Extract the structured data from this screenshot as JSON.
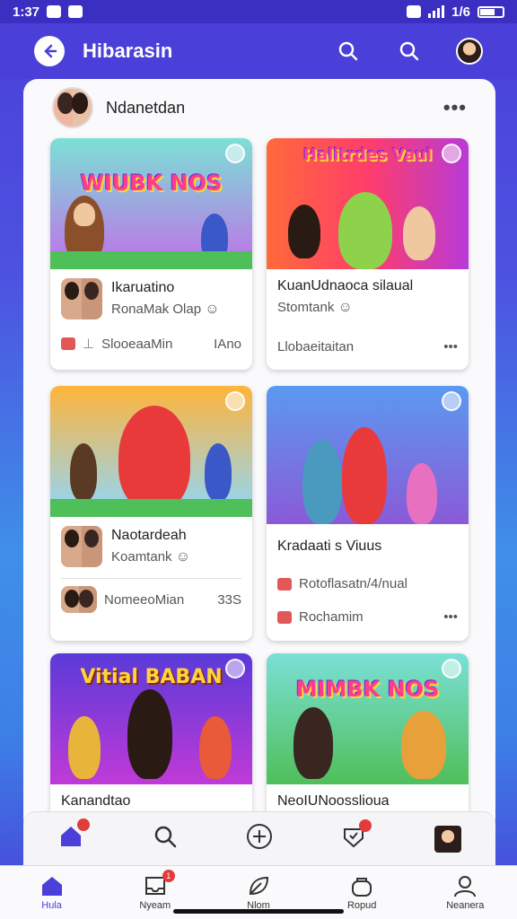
{
  "status_bar": {
    "time": "1:37",
    "right_text": "1/6"
  },
  "header": {
    "title": "Hibarasin"
  },
  "group": {
    "name": "Ndanetdan"
  },
  "cards": [
    {
      "thumb_title": "WIUBK NOS",
      "title": "Ikaruatino",
      "subtitle": "RonaMak Olap",
      "foot_left": "SlooeaaMin",
      "foot_right": "IAno"
    },
    {
      "thumb_title": "Halitrdes Vaul",
      "title": "KuanUdnaoca silaual",
      "subtitle": "Stomtank",
      "foot_left": "Llobaeitaitan",
      "foot_right": "•••"
    },
    {
      "thumb_title": "",
      "title": "Naotardeah",
      "subtitle": "Koamtank",
      "foot_left": "NomeeoMian",
      "foot_right": "33S"
    },
    {
      "thumb_title": "",
      "title": "Kradaati s Viuus",
      "subtitle": "Rotoflasatn/4/nual",
      "foot_left": "Rochamim",
      "foot_right": "•••"
    },
    {
      "thumb_title": "Vitial BABAN",
      "title": "Kanandtao",
      "subtitle": "",
      "foot_left": "",
      "foot_right": ""
    },
    {
      "thumb_title": "MIMBK NOS",
      "title": "NeoIUNoosslioua",
      "subtitle": "",
      "foot_left": "",
      "foot_right": ""
    }
  ],
  "tabs": [
    {
      "label": "Hula",
      "icon": "home-icon",
      "badge": ""
    },
    {
      "label": "Nyeam",
      "icon": "inbox-icon",
      "badge": "1"
    },
    {
      "label": "Nlom",
      "icon": "leaf-icon",
      "badge": ""
    },
    {
      "label": "Ropud",
      "icon": "bag-icon",
      "badge": ""
    },
    {
      "label": "Neanera",
      "icon": "profile-icon",
      "badge": ""
    }
  ],
  "colors": {
    "accent": "#4a3fd8",
    "badge": "#e23b3b"
  }
}
